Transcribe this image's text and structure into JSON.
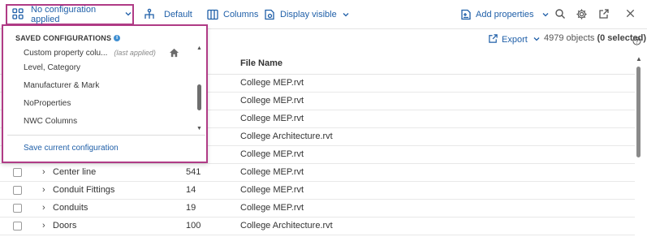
{
  "toolbar": {
    "config_label": "No configuration applied",
    "default_label": "Default",
    "columns_label": "Columns",
    "display_label": "Display visible",
    "add_properties_label": "Add properties"
  },
  "subbar": {
    "export_label": "Export",
    "count_prefix": "4979 objects",
    "count_selected": "(0 selected)"
  },
  "table": {
    "file_header": "File Name",
    "rows": [
      {
        "name": "",
        "count": "",
        "file": "College MEP.rvt"
      },
      {
        "name": "",
        "count": "",
        "file": "College MEP.rvt"
      },
      {
        "name": "",
        "count": "",
        "file": "College MEP.rvt"
      },
      {
        "name": "",
        "count": "",
        "file": "College Architecture.rvt"
      },
      {
        "name": "",
        "count": "",
        "file": "College MEP.rvt"
      },
      {
        "name": "Center line",
        "count": "541",
        "file": "College MEP.rvt"
      },
      {
        "name": "Conduit Fittings",
        "count": "14",
        "file": "College MEP.rvt"
      },
      {
        "name": "Conduits",
        "count": "19",
        "file": "College MEP.rvt"
      },
      {
        "name": "Doors",
        "count": "100",
        "file": "College Architecture.rvt"
      }
    ]
  },
  "dropdown": {
    "heading": "SAVED CONFIGURATIONS",
    "items": [
      {
        "label": "Custom property colu...",
        "note": "(last applied)"
      },
      {
        "label": "Level, Category",
        "note": ""
      },
      {
        "label": "Manufacturer & Mark",
        "note": ""
      },
      {
        "label": "NoProperties",
        "note": ""
      },
      {
        "label": "NWC Columns",
        "note": ""
      }
    ],
    "save_label": "Save current configuration"
  },
  "colors": {
    "accent": "#1f5fa8",
    "highlight_border": "#b03b86",
    "info": "#3f8fd2"
  },
  "icons": [
    "grid-icon",
    "chevron-down-icon",
    "hierarchy-icon",
    "columns-icon",
    "display-icon",
    "add-properties-icon",
    "search-icon",
    "gear-icon",
    "external-link-icon",
    "close-icon",
    "export-icon",
    "help-icon",
    "home-icon",
    "info-icon"
  ]
}
